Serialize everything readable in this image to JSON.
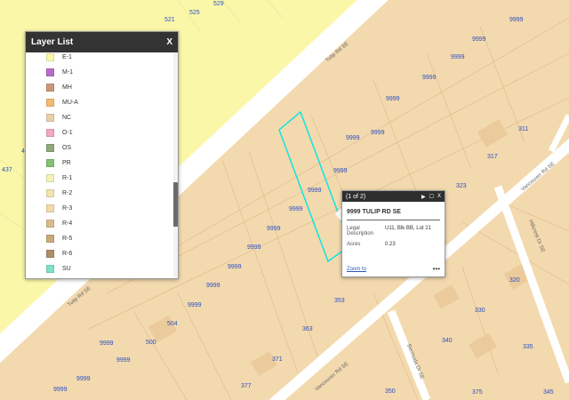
{
  "map": {
    "road_labels": {
      "tulip_upper": "Tulip Rd SE",
      "tulip_lower": "Tulip Rd SE",
      "vancouver_lower": "Vancouver Rd SE",
      "vancouver_right": "Vancouver Rd SE",
      "hillcrest": "Hillcrest Dr SE",
      "bermuda": "Bermuda Dr SE"
    },
    "parcel_labels": {
      "p521": "521",
      "p525": "525",
      "p529": "529",
      "p9999_a": "9999",
      "p9999_b": "9999",
      "p9999_c": "9999",
      "p9999_d": "9999",
      "p9999_e": "9999",
      "p9999_f": "9999",
      "p9999_g": "9999",
      "p9999_h": "9999",
      "p9999_i": "9999",
      "p9999_j": "9999",
      "p9999_k": "9999",
      "p9999_l": "9999",
      "p9999_m": "9999",
      "p9999_n": "9999",
      "p9999_o": "9999",
      "p9999_p": "9999",
      "p9999_q": "9999",
      "p311": "311",
      "p317": "317",
      "p323": "323",
      "p320": "320",
      "p330": "330",
      "p335": "335",
      "p340": "340",
      "p345": "345",
      "p353": "353",
      "p363": "363",
      "p371": "371",
      "p377": "377",
      "p375": "375",
      "p350": "350",
      "p500": "500",
      "p504": "504",
      "p437": "437",
      "p4": "4"
    },
    "colors": {
      "zone_r3": "#f3d9ae",
      "zone_r1": "#fbf7a8",
      "road": "#ffffff",
      "highlight": "#00e5e5"
    }
  },
  "layer_list": {
    "title": "Layer List",
    "close": "X",
    "items": [
      {
        "label": "E-1",
        "color": "#fbf7a8"
      },
      {
        "label": "M-1",
        "color": "#b86bc7"
      },
      {
        "label": "MH",
        "color": "#c89a7a"
      },
      {
        "label": "MU-A",
        "color": "#f2ba73"
      },
      {
        "label": "NC",
        "color": "#e8d2ac"
      },
      {
        "label": "O-1",
        "color": "#f4a9c0"
      },
      {
        "label": "OS",
        "color": "#8fa97a"
      },
      {
        "label": "PR",
        "color": "#84c073"
      },
      {
        "label": "R-1",
        "color": "#f5f2b4"
      },
      {
        "label": "R-2",
        "color": "#f4e3b0"
      },
      {
        "label": "R-3",
        "color": "#f3d9ae"
      },
      {
        "label": "R-4",
        "color": "#d8bd8b"
      },
      {
        "label": "R-5",
        "color": "#c9aa7d"
      },
      {
        "label": "R-6",
        "color": "#ad8e67"
      },
      {
        "label": "SU",
        "color": "#7fe0c8"
      }
    ]
  },
  "popup": {
    "counter": "(1 of 2)",
    "next_icon": "▶",
    "maximize_icon": "☐",
    "close_icon": "X",
    "title": "9999 TULIP RD SE",
    "legal_key": "Legal Description",
    "legal_val": "U11, Blk BB, Lot 21",
    "acres_key": "Acres",
    "acres_val": "0.23",
    "zoom_label": "Zoom to",
    "more_label": "•••"
  }
}
